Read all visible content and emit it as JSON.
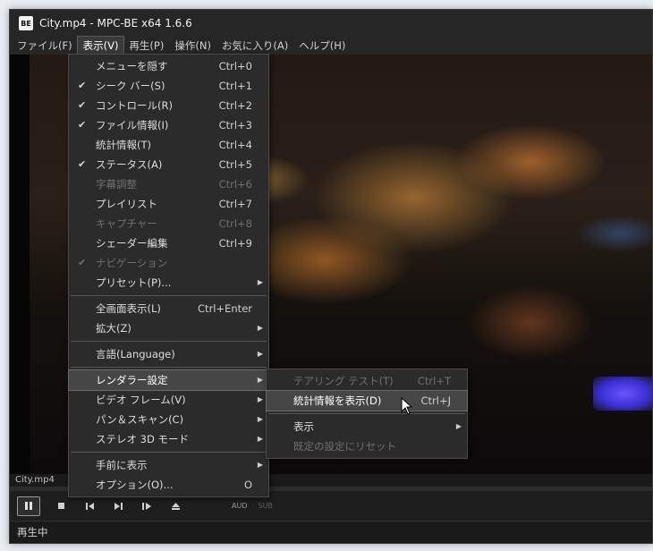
{
  "window": {
    "title": "City.mp4 - MPC-BE x64 1.6.6",
    "app_icon": "BE"
  },
  "menubar": [
    {
      "label": "ファイル(F)"
    },
    {
      "label": "表示(V)"
    },
    {
      "label": "再生(P)"
    },
    {
      "label": "操作(N)"
    },
    {
      "label": "お気に入り(A)"
    },
    {
      "label": "ヘルプ(H)"
    }
  ],
  "view_menu": {
    "items": [
      {
        "label": "メニューを隠す",
        "shortcut": "Ctrl+0",
        "check": ""
      },
      {
        "label": "シーク バー(S)",
        "shortcut": "Ctrl+1",
        "check": "✔"
      },
      {
        "label": "コントロール(R)",
        "shortcut": "Ctrl+2",
        "check": "✔"
      },
      {
        "label": "ファイル情報(I)",
        "shortcut": "Ctrl+3",
        "check": "✔"
      },
      {
        "label": "統計情報(T)",
        "shortcut": "Ctrl+4",
        "check": ""
      },
      {
        "label": "ステータス(A)",
        "shortcut": "Ctrl+5",
        "check": "✔"
      },
      {
        "label": "字幕調整",
        "shortcut": "Ctrl+6",
        "check": ""
      },
      {
        "label": "プレイリスト",
        "shortcut": "Ctrl+7",
        "check": ""
      },
      {
        "label": "キャプチャー",
        "shortcut": "Ctrl+8",
        "check": ""
      },
      {
        "label": "シェーダー編集",
        "shortcut": "Ctrl+9",
        "check": ""
      },
      {
        "label": "ナビゲーション",
        "shortcut": "",
        "check": "✔"
      },
      {
        "label": "プリセット(P)...",
        "shortcut": "",
        "check": ""
      },
      {
        "label": "全画面表示(L)",
        "shortcut": "Ctrl+Enter",
        "check": ""
      },
      {
        "label": "拡大(Z)",
        "shortcut": "",
        "check": ""
      },
      {
        "label": "言語(Language)",
        "shortcut": "",
        "check": ""
      },
      {
        "label": "レンダラー設定",
        "shortcut": "",
        "check": ""
      },
      {
        "label": "ビデオ フレーム(V)",
        "shortcut": "",
        "check": ""
      },
      {
        "label": "パン＆スキャン(C)",
        "shortcut": "",
        "check": ""
      },
      {
        "label": "ステレオ 3D モード",
        "shortcut": "",
        "check": ""
      },
      {
        "label": "手前に表示",
        "shortcut": "",
        "check": ""
      },
      {
        "label": "オプション(O)...",
        "shortcut": "O",
        "check": ""
      }
    ]
  },
  "renderer_submenu": {
    "items": [
      {
        "label": "テアリング テスト(T)",
        "shortcut": "Ctrl+T"
      },
      {
        "label": "統計情報を表示(D)",
        "shortcut": "Ctrl+J"
      },
      {
        "label": "表示",
        "shortcut": ""
      },
      {
        "label": "既定の設定にリセット",
        "shortcut": ""
      }
    ]
  },
  "filename": "City.mp4",
  "controls": {
    "aud_label": "AUD",
    "sub_label": "SUB"
  },
  "status": "再生中",
  "submenu_arrow": "▶"
}
